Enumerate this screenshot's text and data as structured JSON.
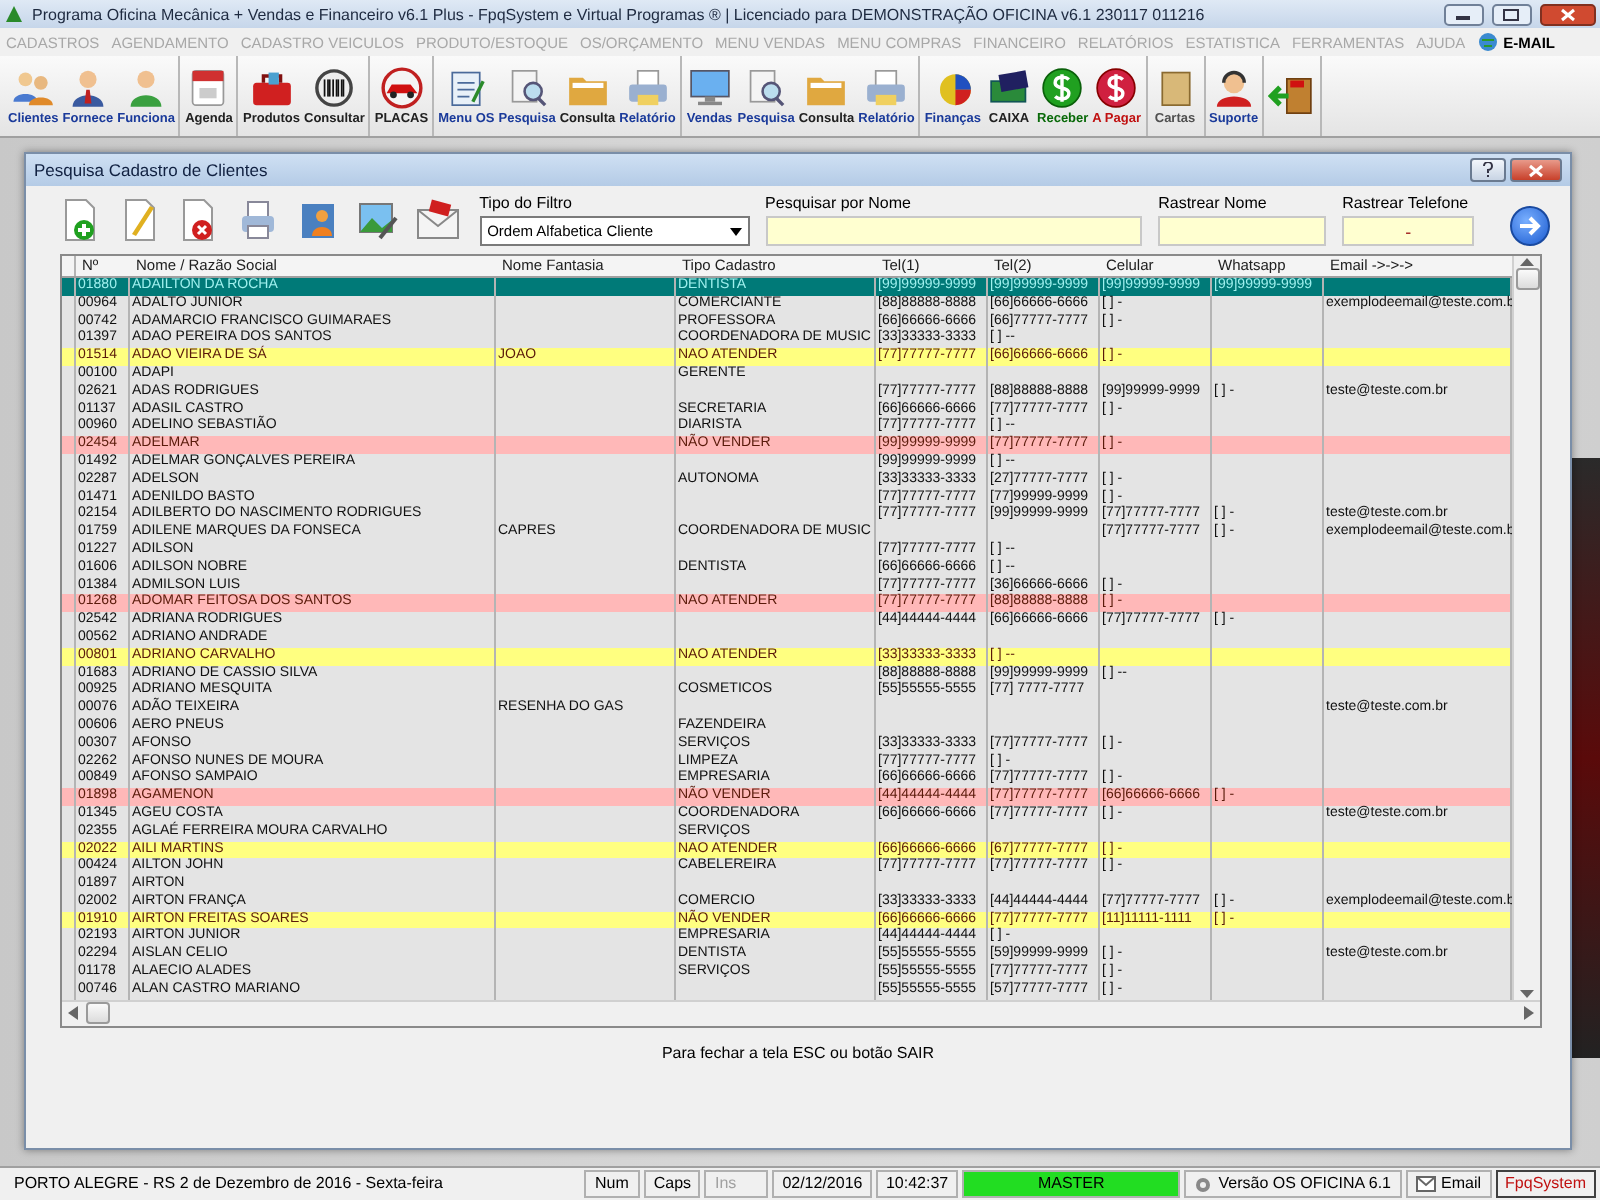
{
  "window": {
    "title": "Programa Oficina Mecânica + Vendas e Financeiro v6.1 Plus - FpqSystem e Virtual Programas ® | Licenciado para  DEMONSTRAÇÃO OFICINA v6.1 230117 011216"
  },
  "menu": [
    {
      "label": "CADASTROS",
      "disabled": true
    },
    {
      "label": "AGENDAMENTO",
      "disabled": true
    },
    {
      "label": "CADASTRO VEICULOS",
      "disabled": true
    },
    {
      "label": "PRODUTO/ESTOQUE",
      "disabled": true
    },
    {
      "label": "OS/ORÇAMENTO",
      "disabled": true
    },
    {
      "label": "MENU VENDAS",
      "disabled": true
    },
    {
      "label": "MENU COMPRAS",
      "disabled": true
    },
    {
      "label": "FINANCEIRO",
      "disabled": true
    },
    {
      "label": "RELATÓRIOS",
      "disabled": true
    },
    {
      "label": "ESTATISTICA",
      "disabled": true
    },
    {
      "label": "FERRAMENTAS",
      "disabled": true
    },
    {
      "label": "AJUDA",
      "disabled": true
    },
    {
      "label": "E-MAIL",
      "disabled": false
    }
  ],
  "toolbar": [
    [
      {
        "label": "Clientes",
        "kind": "people",
        "color": "#1a3a9a"
      },
      {
        "label": "Fornece",
        "kind": "person",
        "color": "#1a3a9a"
      },
      {
        "label": "Funciona",
        "kind": "worker",
        "color": "#1a3a9a"
      }
    ],
    [
      {
        "label": "Agenda",
        "kind": "calendar",
        "color": "#202020"
      }
    ],
    [
      {
        "label": "Produtos",
        "kind": "toolbox",
        "color": "#202020"
      },
      {
        "label": "Consultar",
        "kind": "barcode",
        "color": "#202020"
      }
    ],
    [
      {
        "label": "PLACAS",
        "kind": "car",
        "color": "#202020"
      }
    ],
    [
      {
        "label": "Menu OS",
        "kind": "clipboard",
        "color": "#1a3a9a"
      },
      {
        "label": "Pesquisa",
        "kind": "search",
        "color": "#1a3a9a"
      },
      {
        "label": "Consulta",
        "kind": "folder",
        "color": "#202020"
      },
      {
        "label": "Relatório",
        "kind": "printer",
        "color": "#1a3a9a"
      }
    ],
    [
      {
        "label": "Vendas",
        "kind": "monitor",
        "color": "#1a3a9a"
      },
      {
        "label": "Pesquisa",
        "kind": "search",
        "color": "#1a3a9a"
      },
      {
        "label": "Consulta",
        "kind": "folder",
        "color": "#202020"
      },
      {
        "label": "Relatório",
        "kind": "printer",
        "color": "#1a3a9a"
      }
    ],
    [
      {
        "label": "Finanças",
        "kind": "coins",
        "color": "#1a3a9a"
      },
      {
        "label": "CAIXA",
        "kind": "cash",
        "color": "#202020"
      },
      {
        "label": "Receber",
        "kind": "dollar-green",
        "color": "#0a6a0a"
      },
      {
        "label": "A Pagar",
        "kind": "dollar-red",
        "color": "#c01010"
      }
    ],
    [
      {
        "label": "Cartas",
        "kind": "scroll",
        "color": "#505050"
      }
    ],
    [
      {
        "label": "Suporte",
        "kind": "support",
        "color": "#1a3a9a"
      }
    ],
    [
      {
        "kind": "exit"
      }
    ]
  ],
  "dialog": {
    "title": "Pesquisa Cadastro de Clientes",
    "filter": {
      "label": "Tipo do Filtro",
      "value": "Ordem Alfabetica Cliente"
    },
    "search": {
      "label": "Pesquisar por Nome"
    },
    "track_name": {
      "label": "Rastrear Nome"
    },
    "track_phone": {
      "label": "Rastrear Telefone",
      "value": "-"
    },
    "footer": "Para fechar a tela ESC ou botão SAIR"
  },
  "table": {
    "columns": [
      "Nº",
      "Nome / Razão Social",
      "Nome Fantasia",
      "Tipo Cadastro",
      "Tel(1)",
      "Tel(2)",
      "Celular",
      "Whatsapp",
      "Email ->->->"
    ],
    "rows": [
      {
        "selected": true,
        "cells": [
          "01880",
          "ADAILTON DA ROCHA",
          "",
          "DENTISTA",
          "[99]99999-9999",
          "[99]99999-9999",
          "[99]99999-9999",
          "[99]99999-9999",
          ""
        ]
      },
      {
        "selected": false,
        "cells": [
          "00964",
          "ADALTO JUNIOR",
          "",
          "COMERCIANTE",
          "[88]88888-8888",
          "[66]66666-6666",
          "[ ]  -",
          "",
          "exemplodeemail@teste.com.b"
        ]
      },
      {
        "selected": false,
        "cells": [
          "00742",
          "ADAMARCIO FRANCISCO GUIMARAES",
          "",
          "PROFESSORA",
          "[66]66666-6666",
          "[66]77777-7777",
          "[ ]  -",
          "",
          ""
        ]
      },
      {
        "selected": false,
        "cells": [
          "01397",
          "ADAO PEREIRA DOS SANTOS",
          "",
          "COORDENADORA DE MUSIC",
          "[33]33333-3333",
          "[ ]  --",
          "",
          "",
          ""
        ]
      },
      {
        "selected": false,
        "color": "#ffff80",
        "cells": [
          "01514",
          "ADAO VIEIRA DE SÁ",
          "JOAO",
          "NAO ATENDER",
          "[77]77777-7777",
          "[66]66666-6666",
          "[ ]  -",
          "",
          ""
        ]
      },
      {
        "selected": false,
        "cells": [
          "00100",
          "ADAPI",
          "",
          "GERENTE",
          "",
          "",
          "",
          "",
          ""
        ]
      },
      {
        "selected": false,
        "cells": [
          "02621",
          "ADAS RODRIGUES",
          "",
          "",
          "[77]77777-7777",
          "[88]88888-8888",
          "[99]99999-9999",
          "[ ]  -",
          "teste@teste.com.br"
        ]
      },
      {
        "selected": false,
        "cells": [
          "01137",
          "ADASIL CASTRO",
          "",
          "SECRETARIA",
          "[66]66666-6666",
          "[77]77777-7777",
          "[ ]  -",
          "",
          ""
        ]
      },
      {
        "selected": false,
        "cells": [
          "00960",
          "ADELINO SEBASTIÃO",
          "",
          "DIARISTA",
          "[77]77777-7777",
          "[ ]  --",
          "",
          "",
          ""
        ]
      },
      {
        "selected": false,
        "color": "#ffb8b8",
        "cells": [
          "02454",
          "ADELMAR",
          "",
          "NÃO VENDER",
          "[99]99999-9999",
          "[77]77777-7777",
          "[ ]  -",
          "",
          ""
        ]
      },
      {
        "selected": false,
        "cells": [
          "01492",
          "ADELMAR GONÇALVES PEREIRA",
          "",
          "",
          "[99]99999-9999",
          "[ ]  --",
          "",
          "",
          ""
        ]
      },
      {
        "selected": false,
        "cells": [
          "02287",
          "ADELSON",
          "",
          "AUTONOMA",
          "[33]33333-3333",
          "[27]77777-7777",
          "[ ]  -",
          "",
          ""
        ]
      },
      {
        "selected": false,
        "cells": [
          "01471",
          "ADENILDO BASTO",
          "",
          "",
          "[77]77777-7777",
          "[77]99999-9999",
          "[ ]  -",
          "",
          ""
        ]
      },
      {
        "selected": false,
        "cells": [
          "02154",
          "ADILBERTO DO NASCIMENTO RODRIGUES",
          "",
          "",
          "[77]77777-7777",
          "[99]99999-9999",
          "[77]77777-7777",
          "[ ]  -",
          "teste@teste.com.br"
        ]
      },
      {
        "selected": false,
        "cells": [
          "01759",
          "ADILENE MARQUES DA FONSECA",
          "CAPRES",
          "COORDENADORA DE MUSIC",
          "",
          "",
          "[77]77777-7777",
          "[ ]  -",
          "exemplodeemail@teste.com.b"
        ]
      },
      {
        "selected": false,
        "cells": [
          "01227",
          "ADILSON",
          "",
          "",
          "[77]77777-7777",
          "[ ]  --",
          "",
          "",
          ""
        ]
      },
      {
        "selected": false,
        "cells": [
          "01606",
          "ADILSON NOBRE",
          "",
          "DENTISTA",
          "[66]66666-6666",
          "[ ]  --",
          "",
          "",
          ""
        ]
      },
      {
        "selected": false,
        "cells": [
          "01384",
          "ADMILSON LUIS",
          "",
          "",
          "[77]77777-7777",
          "[36]66666-6666",
          "[ ]  -",
          "",
          ""
        ]
      },
      {
        "selected": false,
        "color": "#ffb8b8",
        "cells": [
          "01268",
          "ADOMAR FEITOSA DOS SANTOS",
          "",
          "NAO ATENDER",
          "[77]77777-7777",
          "[88]88888-8888",
          "[ ]  -",
          "",
          ""
        ]
      },
      {
        "selected": false,
        "cells": [
          "02542",
          "ADRIANA RODRIGUES",
          "",
          "",
          "[44]44444-4444",
          "[66]66666-6666",
          "[77]77777-7777",
          "[ ]  -",
          ""
        ]
      },
      {
        "selected": false,
        "cells": [
          "00562",
          "ADRIANO ANDRADE",
          "",
          "",
          "",
          "",
          "",
          "",
          ""
        ]
      },
      {
        "selected": false,
        "color": "#ffff80",
        "cells": [
          "00801",
          "ADRIANO CARVALHO",
          "",
          "NAO ATENDER",
          "[33]33333-3333",
          "[ ]  --",
          "",
          "",
          ""
        ]
      },
      {
        "selected": false,
        "cells": [
          "01683",
          "ADRIANO DE CASSIO SILVA",
          "",
          "",
          "[88]88888-8888",
          "[99]99999-9999",
          "[ ]  --",
          "",
          ""
        ]
      },
      {
        "selected": false,
        "cells": [
          "00925",
          "ADRIANO MESQUITA",
          "",
          "COSMETICOS",
          "[55]55555-5555",
          "[77] 7777-7777",
          "",
          "",
          ""
        ]
      },
      {
        "selected": false,
        "cells": [
          "00076",
          "ADÃO TEIXEIRA",
          "RESENHA DO GAS",
          "",
          "",
          "",
          "",
          "",
          "teste@teste.com.br"
        ]
      },
      {
        "selected": false,
        "cells": [
          "00606",
          "AERO PNEUS",
          "",
          "FAZENDEIRA",
          "",
          "",
          "",
          "",
          ""
        ]
      },
      {
        "selected": false,
        "cells": [
          "00307",
          "AFONSO",
          "",
          "SERVIÇOS",
          "[33]33333-3333",
          "[77]77777-7777",
          "[ ]  -",
          "",
          ""
        ]
      },
      {
        "selected": false,
        "cells": [
          "02262",
          "AFONSO NUNES DE MOURA",
          "",
          "LIMPEZA",
          "[77]77777-7777",
          "[ ]  -",
          "",
          "",
          ""
        ]
      },
      {
        "selected": false,
        "cells": [
          "00849",
          "AFONSO SAMPAIO",
          "",
          "EMPRESARIA",
          "[66]66666-6666",
          "[77]77777-7777",
          "[ ]  -",
          "",
          ""
        ]
      },
      {
        "selected": false,
        "color": "#ffb8b8",
        "cells": [
          "01898",
          "AGAMENON",
          "",
          "NÃO VENDER",
          "[44]44444-4444",
          "[77]77777-7777",
          "[66]66666-6666",
          "[ ]  -",
          ""
        ]
      },
      {
        "selected": false,
        "cells": [
          "01345",
          "AGEU COSTA",
          "",
          "COORDENADORA",
          "[66]66666-6666",
          "[77]77777-7777",
          "[ ]  -",
          "",
          "teste@teste.com.br"
        ]
      },
      {
        "selected": false,
        "cells": [
          "02355",
          "AGLAÉ FERREIRA MOURA CARVALHO",
          "",
          "SERVIÇOS",
          "",
          "",
          "",
          "",
          ""
        ]
      },
      {
        "selected": false,
        "color": "#ffff80",
        "cells": [
          "02022",
          "AILI MARTINS",
          "",
          "NAO ATENDER",
          "[66]66666-6666",
          "[67]77777-7777",
          "[ ]  -",
          "",
          ""
        ]
      },
      {
        "selected": false,
        "cells": [
          "00424",
          "AILTON JOHN",
          "",
          "CABELEREIRA",
          "[77]77777-7777",
          "[77]77777-7777",
          "[ ]  -",
          "",
          ""
        ]
      },
      {
        "selected": false,
        "cells": [
          "01897",
          "AIRTON",
          "",
          "",
          "",
          "",
          "",
          "",
          ""
        ]
      },
      {
        "selected": false,
        "cells": [
          "02002",
          "AIRTON FRANÇA",
          "",
          "COMERCIO",
          "[33]33333-3333",
          "[44]44444-4444",
          "[77]77777-7777",
          "[ ]  -",
          "exemplodeemail@teste.com.b"
        ]
      },
      {
        "selected": false,
        "color": "#ffff80",
        "cells": [
          "01910",
          "AIRTON FREITAS SOARES",
          "",
          "NÃO VENDER",
          "[66]66666-6666",
          "[77]77777-7777",
          "[11]11111-1111",
          "[ ]  -",
          ""
        ]
      },
      {
        "selected": false,
        "cells": [
          "02193",
          "AIRTON JUNIOR",
          "",
          "EMPRESARIA",
          "[44]44444-4444",
          "[ ]  -",
          "",
          "",
          ""
        ]
      },
      {
        "selected": false,
        "cells": [
          "02294",
          "AISLAN CELIO",
          "",
          "DENTISTA",
          "[55]55555-5555",
          "[59]99999-9999",
          "[ ]  -",
          "",
          "teste@teste.com.br"
        ]
      },
      {
        "selected": false,
        "cells": [
          "01178",
          "ALAECIO ALADES",
          "",
          "SERVIÇOS",
          "[55]55555-5555",
          "[77]77777-7777",
          "[ ]  -",
          "",
          ""
        ]
      },
      {
        "selected": false,
        "cells": [
          "00746",
          "ALAN CASTRO MARIANO",
          "",
          "",
          "[55]55555-5555",
          "[57]77777-7777",
          "[ ]  -",
          "",
          ""
        ]
      }
    ]
  },
  "status_bar": [
    {
      "text": "PORTO ALEGRE - RS   2 de Dezembro de 2016 - Sexta-feira",
      "kind": "location"
    },
    {
      "text": "Num",
      "kind": "plain"
    },
    {
      "text": "Caps",
      "kind": "plain"
    },
    {
      "text": "Ins",
      "kind": "dim"
    },
    {
      "text": "02/12/2016",
      "kind": "plain"
    },
    {
      "text": "10:42:37",
      "kind": "plain"
    },
    {
      "text": "MASTER",
      "kind": "user"
    },
    {
      "text": "Versão OS OFICINA 6.1",
      "kind": "version"
    },
    {
      "text": "Email",
      "kind": "email"
    },
    {
      "text": "FpqSystem",
      "kind": "brand"
    }
  ]
}
